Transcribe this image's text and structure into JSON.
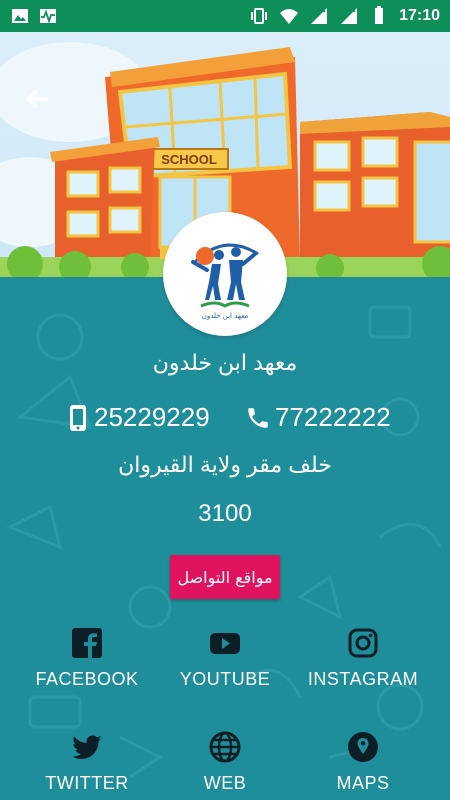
{
  "status_bar": {
    "time": "17:10",
    "icons": [
      "image-icon",
      "activity-icon",
      "vibrate-icon",
      "wifi-icon",
      "signal-icon",
      "signal-icon",
      "battery-icon"
    ]
  },
  "header": {
    "school_sign": "SCHOOL",
    "back_icon": "arrow-left-icon"
  },
  "profile": {
    "name": "معهد ابن خلدون",
    "logo_caption": "معهد ابن خلدون",
    "phone_mobile": "25229229",
    "phone_landline": "77222222",
    "address": "خلف مقر ولاية القيروان",
    "postal_code": "3100",
    "contact_button": "مواقع التواصل"
  },
  "social": [
    {
      "label": "FACEBOOK",
      "icon": "facebook-icon"
    },
    {
      "label": "YOUTUBE",
      "icon": "youtube-icon"
    },
    {
      "label": "INSTAGRAM",
      "icon": "instagram-icon"
    },
    {
      "label": "TWITTER",
      "icon": "twitter-icon"
    },
    {
      "label": "WEB",
      "icon": "globe-icon"
    },
    {
      "label": "MAPS",
      "icon": "map-pin-icon"
    }
  ],
  "colors": {
    "status_bar": "#0e8f5a",
    "background": "#1f8e9b",
    "accent_button": "#e0145e"
  }
}
